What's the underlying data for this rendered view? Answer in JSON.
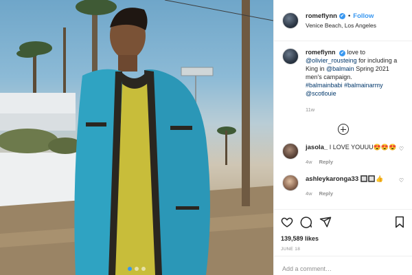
{
  "post": {
    "username": "romeflynn",
    "verified_mark": "✔",
    "separator": "•",
    "follow_label": "Follow",
    "location": "Venice Beach, Los Angeles"
  },
  "caption": {
    "username": "romeflynn",
    "verified_mark": "✔",
    "text_1": "love to ",
    "mention_1": "@olivier_rousteing",
    "text_2": " for including a King in ",
    "mention_2": "@balmain",
    "text_3": " Spring 2021 men's campaign.",
    "hashtag_1": "#balmainbabi",
    "hashtag_2": "#balmainarmy",
    "mention_3": "@scotlouie",
    "time": "11w"
  },
  "comments": [
    {
      "username": "jasola_",
      "text": "I LOVE YOUUU😍😍😍",
      "time": "4w",
      "reply_label": "Reply"
    },
    {
      "username": "ashleykaronga33",
      "text": "🔲🔲👍",
      "time": "4w",
      "reply_label": "Reply"
    }
  ],
  "engagement": {
    "likes": "139,589 likes",
    "date": "JUNE 18"
  },
  "add_comment": {
    "placeholder": "Add a comment…"
  },
  "icons": {
    "heart": "heart-icon",
    "comment": "comment-icon",
    "share": "share-icon",
    "bookmark": "bookmark-icon",
    "load_more": "plus-circle-icon"
  },
  "colors": {
    "link_blue": "#3897f0",
    "mention_blue": "#00376b",
    "secondary_text": "#8e8e8e",
    "border": "#efefef"
  },
  "carousel": {
    "total": 3,
    "active_index": 0
  }
}
